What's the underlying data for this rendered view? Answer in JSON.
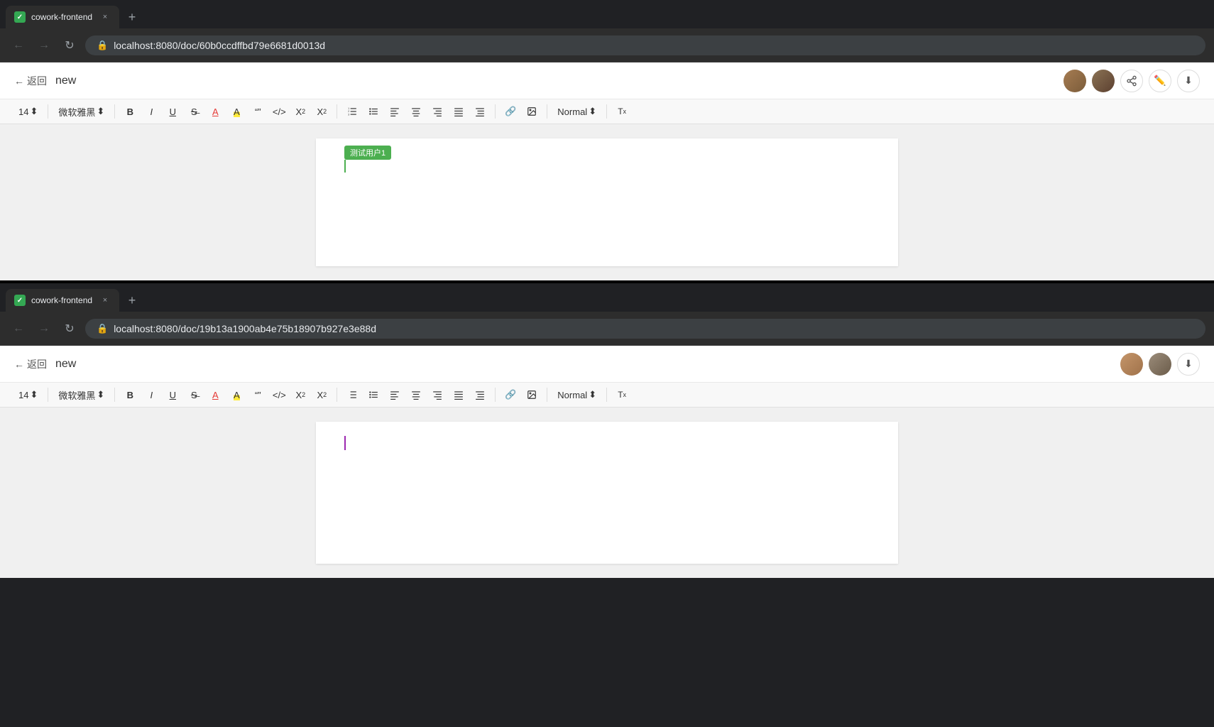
{
  "browser1": {
    "tab_favicon": "✓",
    "tab_title": "cowork-frontend",
    "url": "localhost:8080/doc/60b0ccdffbd79e6681d0013d",
    "new_tab_icon": "+",
    "close_icon": "×"
  },
  "browser2": {
    "tab_title": "cowork-frontend",
    "url": "localhost:8080/doc/19b13a1900ab4e75b18907b927e3e88d",
    "close_icon": "×"
  },
  "app1": {
    "back_label": "返回",
    "doc_title": "new",
    "toolbar": {
      "font_size": "14",
      "font_name": "微软雅黑",
      "bold": "B",
      "italic": "I",
      "underline": "U",
      "strikethrough": "S",
      "font_color": "A",
      "highlight": "A",
      "quote": "\"\"",
      "code": "</>",
      "subscript": "X₂",
      "superscript": "X²",
      "ordered_list": "≡",
      "unordered_list": "≡",
      "align_left": "≡",
      "align_center": "≡",
      "align_right": "≡",
      "justify": "≡",
      "indent": "≡",
      "link": "🔗",
      "image": "🖼",
      "normal_dropdown": "Normal",
      "clear_format": "Tx"
    },
    "user_label": "测试用户1",
    "cursor_color": "#4CAF50"
  },
  "app2": {
    "back_label": "返回",
    "doc_title": "new",
    "toolbar": {
      "font_size": "14",
      "font_name": "微软雅黑",
      "bold": "B",
      "italic": "I",
      "underline": "U",
      "strikethrough": "S",
      "font_color": "A",
      "highlight": "A",
      "quote": "\"\"",
      "code": "</>",
      "subscript": "X₂",
      "superscript": "X²",
      "ordered_list": "≡",
      "unordered_list": "≡",
      "align_left": "≡",
      "align_center": "≡",
      "align_right": "≡",
      "justify": "≡",
      "indent": "≡",
      "link": "🔗",
      "image": "🖼",
      "normal_dropdown": "Normal",
      "clear_format": "Tx"
    },
    "cursor_color": "#9c27b0"
  },
  "colors": {
    "brand_green": "#34a853",
    "cursor_green": "#4CAF50",
    "cursor_purple": "#9c27b0",
    "user_label_bg": "#4CAF50"
  }
}
